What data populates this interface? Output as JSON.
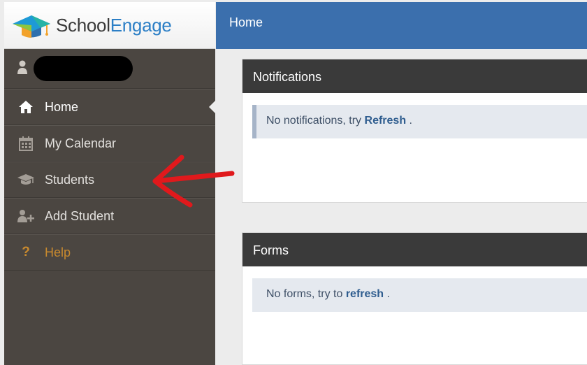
{
  "brand": {
    "name_part1": "School",
    "name_part2": "Engage"
  },
  "header": {
    "title": "Home"
  },
  "sidebar": {
    "items": [
      {
        "label": "Home",
        "icon": "home-icon"
      },
      {
        "label": "My Calendar",
        "icon": "calendar-icon"
      },
      {
        "label": "Students",
        "icon": "graduation-cap-icon"
      },
      {
        "label": "Add Student",
        "icon": "add-user-icon"
      },
      {
        "label": "Help",
        "icon": "question-icon"
      }
    ]
  },
  "notifications": {
    "title": "Notifications",
    "message_prefix": "No notifications, try",
    "link": "Refresh",
    "message_suffix": "."
  },
  "forms": {
    "title": "Forms",
    "message_prefix": "No forms, try to",
    "link": "refresh",
    "message_suffix": "."
  },
  "colors": {
    "sidebar_bg": "#4b4641",
    "topbar_bg": "#3b6fad",
    "panel_header_bg": "#3a3a3a",
    "help_accent": "#c98a2e",
    "annotation_arrow": "#e0191c"
  }
}
